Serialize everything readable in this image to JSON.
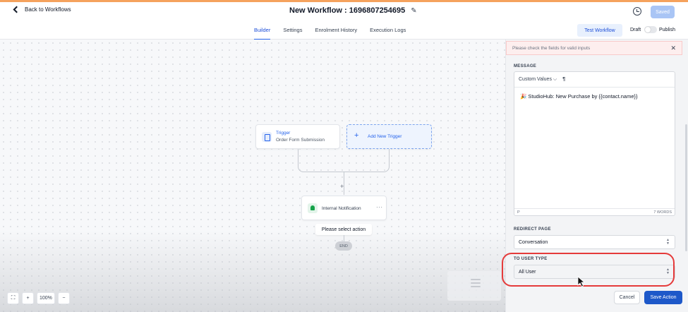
{
  "header": {
    "back_label": "Back to Workflows",
    "title": "New Workflow : 1696807254695",
    "saved_label": "Saved"
  },
  "tabs": [
    {
      "label": "Builder",
      "active": true
    },
    {
      "label": "Settings",
      "active": false
    },
    {
      "label": "Enrolment History",
      "active": false
    },
    {
      "label": "Execution Logs",
      "active": false
    }
  ],
  "toolbar": {
    "test_label": "Test Workflow",
    "draft_label": "Draft",
    "publish_label": "Publish"
  },
  "canvas": {
    "trigger_title": "Trigger",
    "trigger_subtitle": "Order Form Submission",
    "add_trigger_label": "Add New Trigger",
    "action_label": "Internal Notification",
    "action_menu": "···",
    "hint": "Please select action",
    "end_label": "END",
    "zoom": "100%",
    "zoom_in": "+",
    "zoom_out": "−"
  },
  "panel": {
    "error_text": "Please check the fields for valid inputs",
    "message_label": "MESSAGE",
    "custom_values_label": "Custom Values",
    "message_text": "🎉 StudioHub: New Purchase by {{contact.name}}",
    "editor_tag": "P",
    "word_count": "7 WORDS",
    "redirect_label": "REDIRECT PAGE",
    "redirect_value": "Conversation",
    "user_type_label": "TO USER TYPE",
    "user_type_value": "All User",
    "cancel_label": "Cancel",
    "save_label": "Save Action"
  },
  "colors": {
    "accent": "#2563eb",
    "save_button": "#1d58c9",
    "highlight": "#e53b3b",
    "error_bg": "#fdeeee"
  }
}
